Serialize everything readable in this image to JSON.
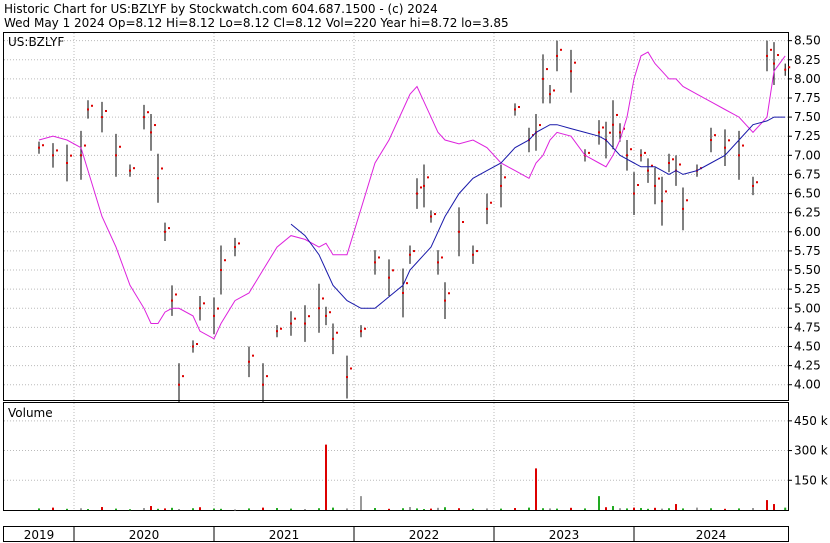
{
  "header": {
    "line1": "Historic Chart for US:BZLYF by Stockwatch.com 604.687.1500 - (c) 2024",
    "line2": "Wed May  1 2024  Op=8.12  Hi=8.12  Lo=8.12  Cl=8.12  Vol=220  Year hi=8.72  lo=3.85"
  },
  "colors": {
    "price": "#dd0000",
    "range": "#000000",
    "ma_short": "#dd22dd",
    "ma_long": "#1a1aaa",
    "vol_up": "#22aa22",
    "vol_down": "#dd0000",
    "vol_flat": "#999999"
  },
  "chart_data": [
    {
      "type": "line",
      "panel": "price",
      "title": "US:BZLYF",
      "x_labels": [
        "2019",
        "2020",
        "2021",
        "2022",
        "2023",
        "2024"
      ],
      "ylim": [
        3.8,
        8.6
      ],
      "y_ticks": [
        "8.50",
        "8.25",
        "8.00",
        "7.75",
        "7.50",
        "7.25",
        "7.00",
        "6.75",
        "6.50",
        "6.25",
        "6.00",
        "5.75",
        "5.50",
        "5.25",
        "5.00",
        "4.75",
        "4.50",
        "4.25",
        "4.00"
      ],
      "grid": true,
      "x": [
        2019.0,
        2019.1,
        2019.2,
        2019.3,
        2019.35,
        2019.45,
        2019.55,
        2019.65,
        2019.75,
        2019.8,
        2019.85,
        2019.9,
        2019.95,
        2020.0,
        2020.1,
        2020.15,
        2020.25,
        2020.3,
        2020.4,
        2020.5,
        2020.6,
        2020.7,
        2020.8,
        2020.9,
        2021.0,
        2021.05,
        2021.1,
        2021.2,
        2021.3,
        2021.4,
        2021.5,
        2021.6,
        2021.65,
        2021.7,
        2021.75,
        2021.8,
        2021.85,
        2021.9,
        2022.0,
        2022.1,
        2022.2,
        2022.3,
        2022.4,
        2022.5,
        2022.55,
        2022.6,
        2022.65,
        2022.7,
        2022.8,
        2022.9,
        2023.0,
        2023.05,
        2023.1,
        2023.15,
        2023.2,
        2023.25,
        2023.3,
        2023.35,
        2023.4,
        2023.45,
        2023.5,
        2023.55,
        2023.6,
        2023.7,
        2023.8,
        2023.9,
        2024.0,
        2024.1,
        2024.2,
        2024.25,
        2024.33
      ],
      "series": [
        {
          "values": [
            7.1,
            7.0,
            6.9,
            7.0,
            7.6,
            7.5,
            7.0,
            6.8,
            7.5,
            7.3,
            6.7,
            6.0,
            5.1,
            4.0,
            4.5,
            5.0,
            4.9,
            5.5,
            5.8,
            4.3,
            4.0,
            4.7,
            4.8,
            4.8,
            5.0,
            4.9,
            4.6,
            4.1,
            4.7,
            5.6,
            5.4,
            5.2,
            5.7,
            6.5,
            6.6,
            6.2,
            5.6,
            5.1,
            6.0,
            5.7,
            6.3,
            6.6,
            7.6,
            7.2,
            7.3,
            8.0,
            7.8,
            8.3,
            8.1,
            7.0,
            7.3,
            7.2,
            7.4,
            7.3,
            7.0,
            6.5,
            7.0,
            6.8,
            6.6,
            6.4,
            6.9,
            6.8,
            6.3,
            6.8,
            7.2,
            7.1,
            7.0,
            6.6,
            8.3,
            8.2,
            8.12
          ]
        },
        {
          "values": [
            7.2,
            7.25,
            7.2,
            7.1,
            6.8,
            6.2,
            5.8,
            5.3,
            5.0,
            4.8,
            4.8,
            4.95,
            5.0,
            5.0,
            4.9,
            4.7,
            4.6,
            4.8,
            5.1,
            5.2,
            5.5,
            5.8,
            5.95,
            5.9,
            5.8,
            5.85,
            5.7,
            5.7,
            6.3,
            6.9,
            7.2,
            7.6,
            7.8,
            7.9,
            7.7,
            7.5,
            7.3,
            7.2,
            7.15,
            7.2,
            7.1,
            6.9,
            6.8,
            6.7,
            6.9,
            7.0,
            7.2,
            7.3,
            7.25,
            7.0,
            6.9,
            6.85,
            7.0,
            7.2,
            7.5,
            8.0,
            8.3,
            8.35,
            8.2,
            8.1,
            8.0,
            8.0,
            7.9,
            7.8,
            7.7,
            7.6,
            7.5,
            7.3,
            7.5,
            8.1,
            8.3
          ]
        },
        {
          "values": [
            null,
            null,
            null,
            null,
            null,
            null,
            null,
            null,
            null,
            null,
            null,
            null,
            null,
            null,
            null,
            null,
            null,
            null,
            null,
            null,
            null,
            null,
            6.1,
            5.95,
            5.7,
            5.5,
            5.3,
            5.1,
            5.0,
            5.0,
            5.15,
            5.3,
            5.5,
            5.6,
            5.7,
            5.8,
            6.0,
            6.2,
            6.5,
            6.7,
            6.8,
            6.9,
            7.1,
            7.2,
            7.3,
            7.35,
            7.4,
            7.4,
            7.35,
            7.3,
            7.25,
            7.2,
            7.1,
            7.0,
            6.95,
            6.9,
            6.85,
            6.85,
            6.85,
            6.8,
            6.75,
            6.8,
            6.75,
            6.8,
            6.9,
            7.0,
            7.2,
            7.4,
            7.45,
            7.5,
            7.5
          ]
        }
      ]
    },
    {
      "type": "bar",
      "panel": "volume",
      "title": "Volume",
      "y_ticks": [
        "450 k",
        "300 k",
        "150 k"
      ],
      "ylim": [
        0,
        540000
      ],
      "values": [
        8000,
        12000,
        6000,
        9000,
        5000,
        15000,
        7000,
        4000,
        10000,
        20000,
        6000,
        8000,
        11000,
        5000,
        9000,
        14000,
        7000,
        6000,
        3000,
        8000,
        12000,
        10000,
        7000,
        5000,
        9000,
        330000,
        12000,
        8000,
        70000,
        10000,
        6000,
        9000,
        15000,
        8000,
        5000,
        7000,
        11000,
        14000,
        9000,
        6000,
        8000,
        7000,
        10000,
        12000,
        210000,
        9000,
        8000,
        7000,
        11000,
        8000,
        70000,
        14000,
        20000,
        9000,
        8000,
        12000,
        10000,
        6000,
        11000,
        7000,
        9000,
        30000,
        8000,
        12000,
        9000,
        6000,
        8000,
        10000,
        50000,
        30000,
        12000
      ],
      "colors_idx": [
        0,
        1,
        0,
        2,
        0,
        1,
        0,
        0,
        2,
        1,
        0,
        1,
        0,
        2,
        0,
        1,
        0,
        0,
        2,
        0,
        1,
        0,
        0,
        2,
        0,
        1,
        0,
        2,
        2,
        0,
        1,
        0,
        2,
        0,
        0,
        1,
        2,
        0,
        1,
        0,
        2,
        0,
        1,
        0,
        1,
        0,
        2,
        0,
        1,
        0,
        0,
        1,
        0,
        2,
        0,
        1,
        0,
        0,
        1,
        2,
        0,
        1,
        0,
        2,
        0,
        1,
        0,
        2,
        1,
        1,
        0
      ]
    }
  ]
}
